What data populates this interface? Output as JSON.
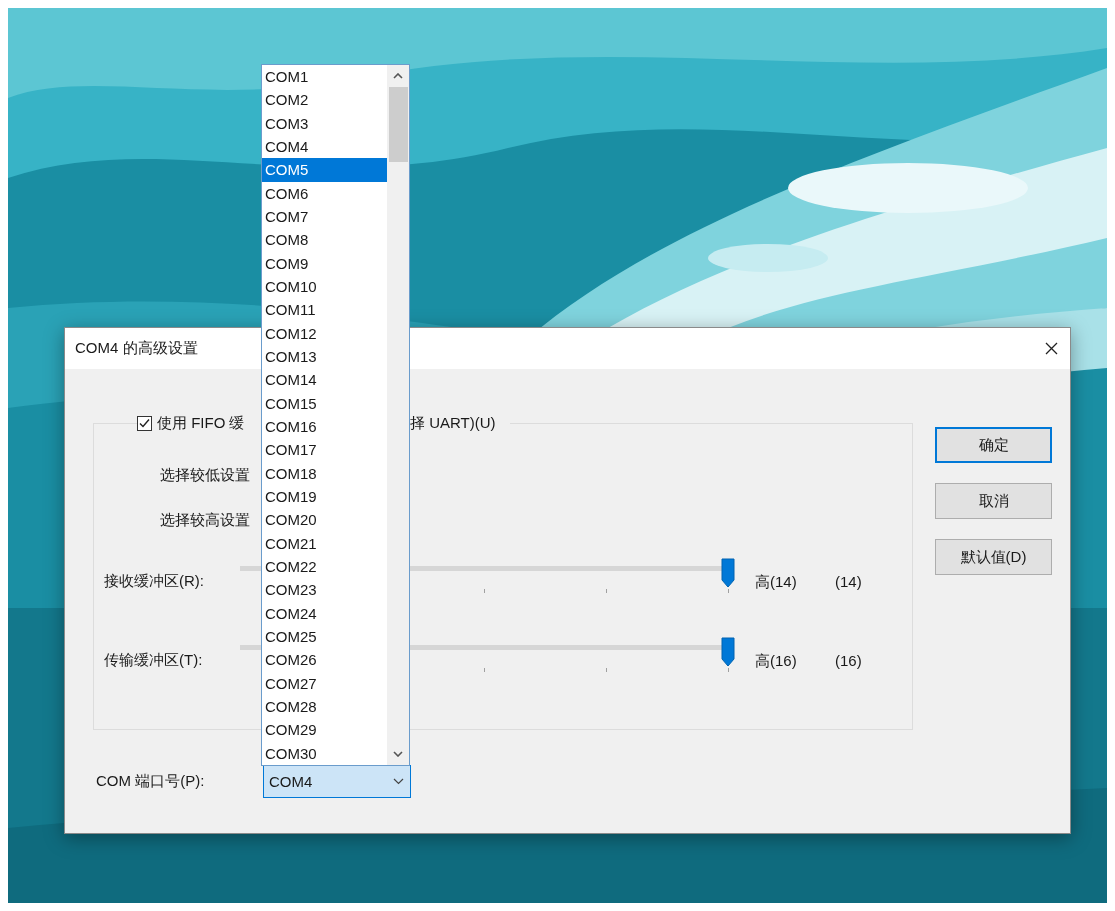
{
  "dialog": {
    "title": "COM4 的高级设置",
    "fifo_checkbox": {
      "checked": true,
      "label_start": "使用 FIFO 缓",
      "label_end": "择 UART)(U)"
    },
    "notes": [
      "选择较低设置",
      "选择较高设置"
    ],
    "sliders": [
      {
        "label": "接收缓冲区(R):",
        "level": 1,
        "setting": "高(14)",
        "reading": "(14)"
      },
      {
        "label": "传输缓冲区(T):",
        "level": 1,
        "setting": "高(16)",
        "reading": "(16)"
      }
    ],
    "port": {
      "label": "COM 端口号(P):",
      "value": "COM4"
    },
    "buttons": [
      {
        "label": "确定",
        "default": true
      },
      {
        "label": "取消",
        "default": false
      },
      {
        "label": "默认值(D)",
        "default": false
      }
    ]
  },
  "port_list": {
    "items": [
      {
        "label": "COM1",
        "selected": false
      },
      {
        "label": "COM2",
        "selected": false
      },
      {
        "label": "COM3",
        "selected": false
      },
      {
        "label": "COM4",
        "selected": false
      },
      {
        "label": "COM5",
        "selected": true
      },
      {
        "label": "COM6",
        "selected": false
      },
      {
        "label": "COM7",
        "selected": false
      },
      {
        "label": "COM8",
        "selected": false
      },
      {
        "label": "COM9",
        "selected": false
      },
      {
        "label": "COM10",
        "selected": false
      },
      {
        "label": "COM11",
        "selected": false
      },
      {
        "label": "COM12",
        "selected": false
      },
      {
        "label": "COM13",
        "selected": false
      },
      {
        "label": "COM14",
        "selected": false
      },
      {
        "label": "COM15",
        "selected": false
      },
      {
        "label": "COM16",
        "selected": false
      },
      {
        "label": "COM17",
        "selected": false
      },
      {
        "label": "COM18",
        "selected": false
      },
      {
        "label": "COM19",
        "selected": false
      },
      {
        "label": "COM20",
        "selected": false
      },
      {
        "label": "COM21",
        "selected": false
      },
      {
        "label": "COM22",
        "selected": false
      },
      {
        "label": "COM23",
        "selected": false
      },
      {
        "label": "COM24",
        "selected": false
      },
      {
        "label": "COM25",
        "selected": false
      },
      {
        "label": "COM26",
        "selected": false
      },
      {
        "label": "COM27",
        "selected": false
      },
      {
        "label": "COM28",
        "selected": false
      },
      {
        "label": "COM29",
        "selected": false
      },
      {
        "label": "COM30",
        "selected": false
      }
    ]
  }
}
